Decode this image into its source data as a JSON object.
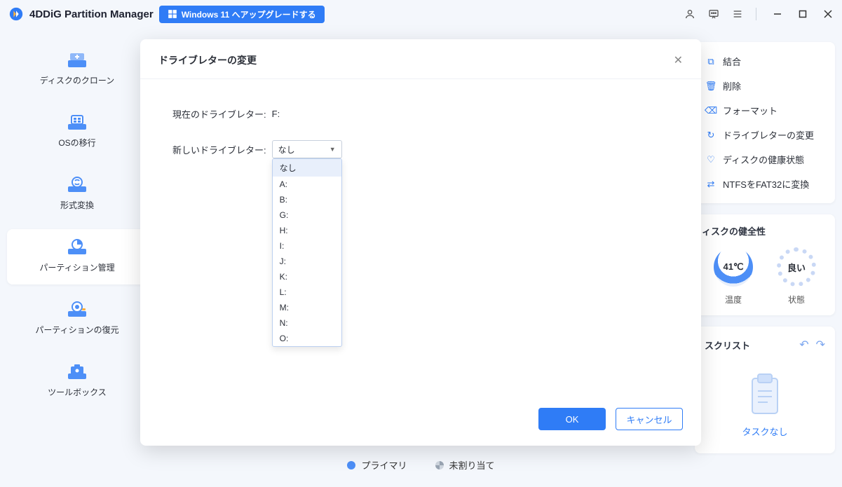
{
  "app": {
    "title": "4DDiG Partition Manager",
    "upgrade_label": "Windows 11 へアップグレードする"
  },
  "sidebar": {
    "items": [
      {
        "label": "ディスクのクローン"
      },
      {
        "label": "OSの移行"
      },
      {
        "label": "形式変換"
      },
      {
        "label": "パーティション管理"
      },
      {
        "label": "パーティションの復元"
      },
      {
        "label": "ツールボックス"
      }
    ]
  },
  "context_menu": {
    "items": [
      {
        "label": "結合"
      },
      {
        "label": "削除"
      },
      {
        "label": "フォーマット"
      },
      {
        "label": "ドライブレターの変更"
      },
      {
        "label": "ディスクの健康状態"
      },
      {
        "label": "NTFSをFAT32に変換"
      }
    ]
  },
  "health": {
    "title": "ィスクの健全性",
    "temp_value": "41℃",
    "temp_label": "温度",
    "state_value": "良い",
    "state_label": "状態"
  },
  "tasks": {
    "title": "スクリスト",
    "empty_label": "タスクなし"
  },
  "legend": {
    "primary": "プライマリ",
    "unallocated": "未割り当て"
  },
  "modal": {
    "title": "ドライブレターの変更",
    "current_label": "現在のドライブレター:",
    "current_value": "F:",
    "new_label": "新しいドライブレター:",
    "selected": "なし",
    "options": [
      "なし",
      "A:",
      "B:",
      "G:",
      "H:",
      "I:",
      "J:",
      "K:",
      "L:",
      "M:",
      "N:",
      "O:"
    ],
    "ok": "OK",
    "cancel": "キャンセル"
  }
}
